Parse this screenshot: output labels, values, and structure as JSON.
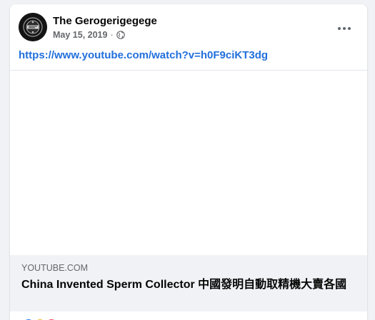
{
  "post": {
    "author_name": "The Gerogerigegege",
    "date": "May 15, 2019",
    "separator": "·",
    "privacy_icon": "globe-icon",
    "more_icon": "more-options-icon",
    "link_text": "https://www.youtube.com/watch?v=h0F9ciKT3dg"
  },
  "link_preview": {
    "domain": "YOUTUBE.COM",
    "title": "China Invented Sperm Collector 中國發明自動取精機大賣各國"
  },
  "reactions": {
    "icons": [
      "like-icon",
      "haha-icon",
      "love-icon"
    ],
    "colors": {
      "like": "#1877f2",
      "haha": "#f7b928",
      "love": "#f33e58"
    }
  },
  "colors": {
    "link": "#216fdb",
    "secondary_text": "#65676b",
    "background": "#f0f2f5"
  }
}
